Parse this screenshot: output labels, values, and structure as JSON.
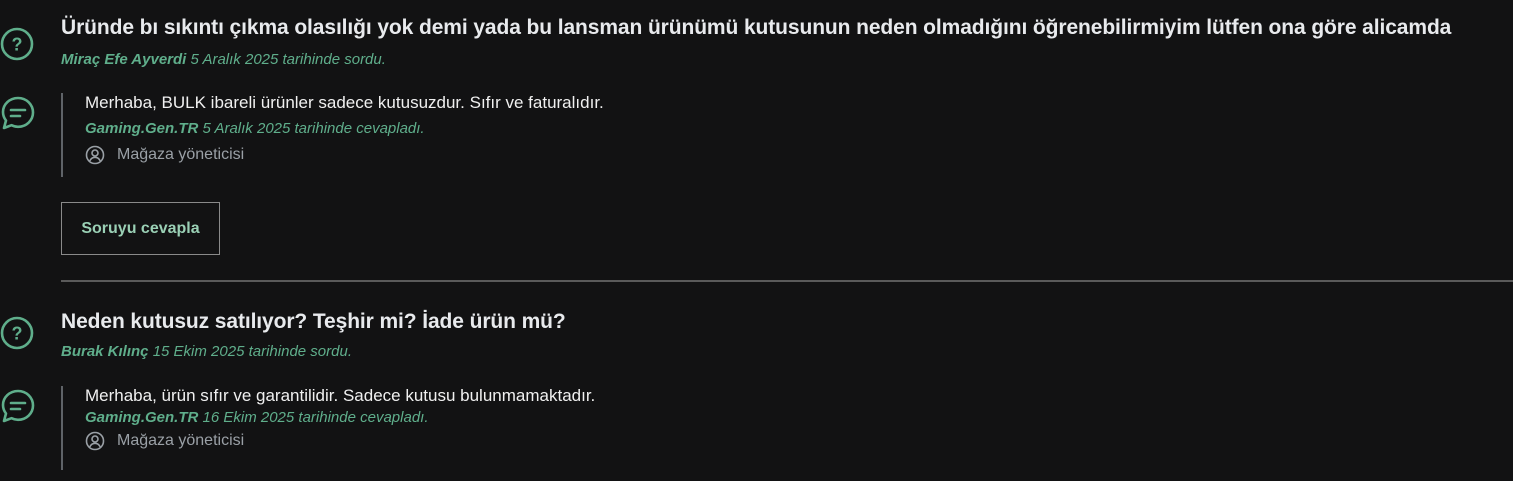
{
  "questions": [
    {
      "icon": "question-circle-icon",
      "title": "Üründe bı sıkıntı çıkma olasılığı yok demi yada bu lansman ürünümü kutusunun neden olmadığını öğrenebilirmiyim lütfen ona göre alicamda",
      "author": "Miraç Efe Ayverdi",
      "date_text": "5 Aralık 2025 tarihinde sordu.",
      "answer": {
        "icon": "chat-bubble-icon",
        "text": "Merhaba, BULK ibareli ürünler sadece kutusuzdur. Sıfır ve faturalıdır.",
        "author": "Gaming.Gen.TR",
        "date_text": "5 Aralık 2025 tarihinde cevapladı.",
        "role": "Mağaza yöneticisi"
      },
      "answer_button_label": "Soruyu cevapla"
    },
    {
      "icon": "question-circle-icon",
      "title": "Neden kutusuz satılıyor? Teşhir mi? İade ürün mü?",
      "author": "Burak Kılınç",
      "date_text": "15 Ekim 2025 tarihinde sordu.",
      "answer": {
        "icon": "chat-bubble-icon",
        "text": "Merhaba, ürün sıfır ve garantilidir. Sadece kutusu bulunmamaktadır.",
        "author": "Gaming.Gen.TR",
        "date_text": "16 Ekim 2025 tarihinde cevapladı.",
        "role": "Mağaza yöneticisi"
      }
    }
  ],
  "colors": {
    "background": "#121213",
    "accent": "#5fae8b",
    "title": "#e8eaed",
    "border": "#5f6368"
  }
}
